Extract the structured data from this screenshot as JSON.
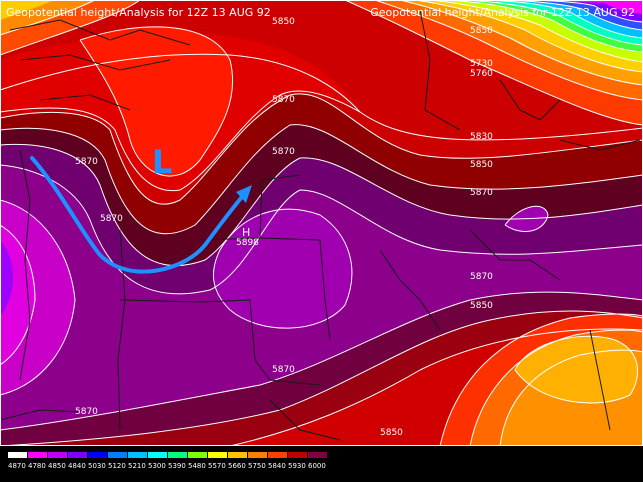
{
  "titles": {
    "left": "Geopotential height/Analysis for 12Z 13 AUG 92",
    "right": "Geopotential height/Analysis for 12Z 13 AUG 92"
  },
  "contour_labels": [
    "5850",
    "5870",
    "5730",
    "5760",
    "5830",
    "5850",
    "5850",
    "5870",
    "5870",
    "5870",
    "5870",
    "5870",
    "5870",
    "5850",
    "5870",
    "5850",
    "5850"
  ],
  "markers": {
    "low": "L",
    "high": "H",
    "high_value": "5898"
  },
  "colorbar": {
    "labels": [
      "4870",
      "4780",
      "4850",
      "4840",
      "5030",
      "5120",
      "5210",
      "5300",
      "5390",
      "5480",
      "5570",
      "5660",
      "5750",
      "5840",
      "5930",
      "6000"
    ],
    "colors": [
      "#ffffff",
      "#ff00ff",
      "#c000ff",
      "#8000ff",
      "#0000ff",
      "#0080ff",
      "#00c0ff",
      "#00ffff",
      "#00ff80",
      "#80ff00",
      "#ffff00",
      "#ffc000",
      "#ff8000",
      "#ff4000",
      "#c00000",
      "#800040"
    ]
  },
  "colors": {
    "background": "#000000",
    "contour": "#ffffff",
    "border": "#202020",
    "arrow": "#1e90ff"
  }
}
